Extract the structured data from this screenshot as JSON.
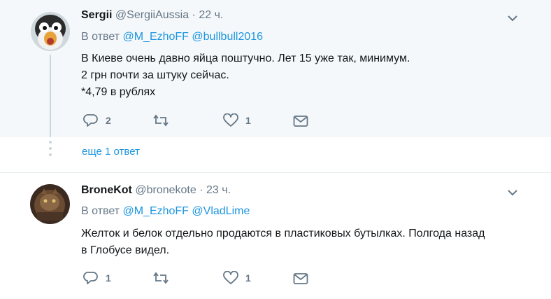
{
  "tweets": [
    {
      "name": "Sergii",
      "handle": "@SergiiAussia",
      "sep": "·",
      "time": "22 ч.",
      "reply_prefix": "В ответ",
      "mentions": [
        "@M_EzhoFF",
        "@bullbull2016"
      ],
      "lines": [
        "В Киеве очень давно яйца поштучно. Лет 15 уже так, минимум.",
        "2 грн почти за штуку сейчас.",
        "*4,79 в рублях"
      ],
      "reply_count": "2",
      "retweet_count": "",
      "like_count": "1"
    },
    {
      "name": "BroneKot",
      "handle": "@bronekote",
      "sep": "·",
      "time": "23 ч.",
      "reply_prefix": "В ответ",
      "mentions": [
        "@M_EzhoFF",
        "@VladLime"
      ],
      "lines": [
        "Желток и белок отдельно продаются в пластиковых бутылках. Полгода назад",
        "в Глобусе видел."
      ],
      "reply_count": "1",
      "retweet_count": "",
      "like_count": "1"
    }
  ],
  "more_replies": "еще 1 ответ",
  "colors": {
    "link": "#1b95e0",
    "muted": "#657786",
    "highlight_bg": "#f5f8fa"
  },
  "icons": [
    "reply-icon",
    "retweet-icon",
    "heart-icon",
    "direct-message-icon",
    "chevron-down-icon"
  ]
}
